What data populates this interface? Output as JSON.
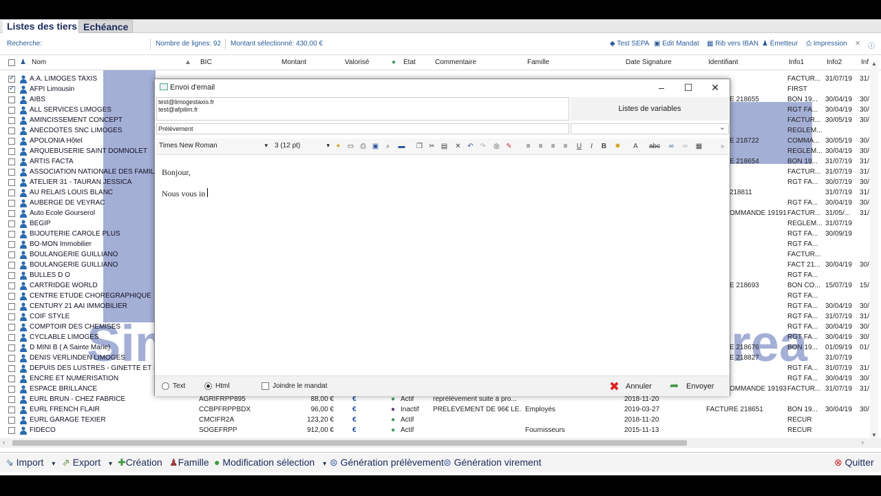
{
  "app": {
    "tabs": [
      "Listes des tiers",
      "Echéance"
    ]
  },
  "infobar": {
    "search_label": "Recherche:",
    "rows_count": "Nombre de lignes: 92",
    "amount_selected": "Montant sélectionné: 430,00 €",
    "tools": [
      "Test SEPA",
      "Edit Mandat",
      "Rib vers IBAN",
      "Émetteur",
      "Impression"
    ]
  },
  "table": {
    "headers": [
      "Nom",
      "BIC",
      "Montant",
      "Valorisé",
      "Etat",
      "Commentaire",
      "Famille",
      "Date Signature",
      "Identifiant",
      "Info1",
      "Info2",
      "Inf"
    ],
    "rows": [
      {
        "name": "A.A. LIMOGES TAXIS",
        "checked": true,
        "info1": "FACTUR...",
        "info2": "31/07/19",
        "info3": "31/"
      },
      {
        "name": "AFPI Limousin",
        "checked": true,
        "info1": "FIRST",
        "info2": "",
        "info3": ""
      },
      {
        "name": "AIBS",
        "checked": false,
        "ident": "E 218655",
        "info1": "BON 19...",
        "info2": "30/04/19",
        "info3": "30/"
      },
      {
        "name": "ALL SERVICES LIMOGES",
        "checked": false,
        "info1": "RGT FA...",
        "info2": "30/04/19",
        "info3": "30/"
      },
      {
        "name": "AMINCISSEMENT CONCEPT",
        "checked": false,
        "info1": "FACTUR...",
        "info2": "30/05/19",
        "info3": "30/"
      },
      {
        "name": "ANECDOTES SNC LIMOGES",
        "checked": false,
        "info1": "REGLEM...",
        "info2": "",
        "info3": ""
      },
      {
        "name": "APOLONIA Hôtel",
        "checked": false,
        "ident": "E 218722",
        "info1": "COMMA...",
        "info2": "30/05/19",
        "info3": "30/"
      },
      {
        "name": "ARQUEBUSERIE SAINT DOMNOLET",
        "checked": false,
        "info1": "REGLEM...",
        "info2": "30/04/19",
        "info3": "30/"
      },
      {
        "name": "ARTIS FACTA",
        "checked": false,
        "ident": "E 218654",
        "info1": "BON 19...",
        "info2": "31/07/19",
        "info3": "31/"
      },
      {
        "name": "ASSOCIATION NATIONALE DES FAMILL",
        "checked": false,
        "info1": "FACTUR...",
        "info2": "31/07/19",
        "info3": "31/"
      },
      {
        "name": "ATELIER 31 - TAURAN JESSICA",
        "checked": false,
        "info1": "RGT FA...",
        "info2": "30/07/19",
        "info3": "30/"
      },
      {
        "name": "AU RELAIS LOUIS BLANC",
        "checked": false,
        "ident": "218811",
        "info1": "",
        "info2": "31/07/19",
        "info3": "31/"
      },
      {
        "name": "AUBERGE DE VEYRAC",
        "checked": false,
        "info1": "RGT FA...",
        "info2": "30/04/19",
        "info3": "30/"
      },
      {
        "name": "Auto Ecole Gourserol",
        "checked": false,
        "ident": "OMMANDE 19191",
        "info1": "FACTUR...",
        "info2": "31/05/...",
        "info3": "31/"
      },
      {
        "name": "BEGIP",
        "checked": false,
        "info1": "REGLEM...",
        "info2": "31/07/19",
        "info3": ""
      },
      {
        "name": "BIJOUTERIE CAROLE PLUS",
        "checked": false,
        "info1": "RGT FA...",
        "info2": "30/09/19",
        "info3": ""
      },
      {
        "name": "BO-MON Immobilier",
        "checked": false,
        "info1": "RGT FA...",
        "info2": "",
        "info3": ""
      },
      {
        "name": "BOULANGERIE GUILLIANO",
        "checked": false,
        "info1": "FACTUR...",
        "info2": "",
        "info3": ""
      },
      {
        "name": "BOULANGERIE GUILLIANO",
        "checked": false,
        "info1": "FACT 21...",
        "info2": "30/04/19",
        "info3": "30/"
      },
      {
        "name": "BULLES D O",
        "checked": false,
        "info1": "RGT FA...",
        "info2": "",
        "info3": ""
      },
      {
        "name": "CARTRIDGE WORLD",
        "checked": false,
        "ident": "E 218693",
        "info1": "BON CO...",
        "info2": "15/07/19",
        "info3": "15/"
      },
      {
        "name": "CENTRE ETUDE CHOREGRAPHIQUE",
        "checked": false,
        "info1": "RGT FA...",
        "info2": "",
        "info3": ""
      },
      {
        "name": "CENTURY 21 AAI IMMOBILIER",
        "checked": false,
        "info1": "RGT FA...",
        "info2": "30/04/19",
        "info3": "30/"
      },
      {
        "name": "COIF STYLE",
        "checked": false,
        "info1": "RGT FA...",
        "info2": "31/07/19",
        "info3": "31/"
      },
      {
        "name": "COMPTOIR DES CHEMISES",
        "checked": false,
        "info1": "RGT FA...",
        "info2": "30/04/19",
        "info3": "30/"
      },
      {
        "name": "CYCLABLE LIMOGES",
        "checked": false,
        "info1": "RGT FA...",
        "info2": "30/04/19",
        "info3": "30/"
      },
      {
        "name": "D MINI B ( A Sainte Marie)",
        "checked": false,
        "ident": "E 218676",
        "info1": "BON 19...",
        "info2": "01/09/19",
        "info3": "01/"
      },
      {
        "name": "DENIS VERLINDEN LIMOGES",
        "checked": false,
        "ident": "E 218827",
        "info1": "",
        "info2": "31/07/19",
        "info3": ""
      },
      {
        "name": "DEPUIS DES LUSTRES - GINETTE ET S",
        "checked": false,
        "info1": "RGT FA...",
        "info2": "31/07/19",
        "info3": "31/"
      },
      {
        "name": "ENCRE ET NUMERISATION",
        "checked": false,
        "info1": "RGT FA...",
        "info2": "30/04/19",
        "info3": "30/"
      },
      {
        "name": "ESPACE BRILLANCE",
        "checked": false,
        "ident": "OMMANDE 19193",
        "info1": "FACTUR...",
        "info2": "31/07/19",
        "info3": "31/"
      },
      {
        "name": "EURL BRUN - CHEZ FABRICE",
        "checked": false,
        "bic": "AGRIFRPP895",
        "montant": "88,00 €",
        "etat": "Actif",
        "etat_color": "#3a9a5a",
        "comment": "reprélèvement suite à pro...",
        "famille": "",
        "date": "2018-11-20",
        "info1": "",
        "info2": "",
        "info3": ""
      },
      {
        "name": "EURL FRENCH FLAIR",
        "checked": false,
        "bic": "CCBPFRPPBDX",
        "montant": "96,00 €",
        "etat": "Inactif",
        "etat_color": "#5a3a7a",
        "comment": "PRELEVEMENT DE 96€ LE...",
        "famille": "Employés",
        "date": "2019-03-27",
        "ident": "FACTURE 218651",
        "info1": "BON 19...",
        "info2": "30/04/19",
        "info3": "30/"
      },
      {
        "name": "EURL GARAGE TEXIER",
        "checked": false,
        "bic": "CMCIFR2A",
        "montant": "123,20 €",
        "etat": "Actif",
        "etat_color": "#3a9a5a",
        "comment": "",
        "famille": "",
        "date": "2018-11-20",
        "info1": "RECUR",
        "info2": "",
        "info3": ""
      },
      {
        "name": "FIDECO",
        "checked": false,
        "bic": "SOGEFRPP",
        "montant": "912,00 €",
        "etat": "Actif",
        "etat_color": "#3a9a5a",
        "comment": "",
        "famille": "Fournisseurs",
        "date": "2015-11-13",
        "info1": "RECUR",
        "info2": "",
        "info3": ""
      }
    ]
  },
  "dialog": {
    "title": "Envoi d'email",
    "recipients": [
      "test@limogestaxis.fr",
      "test@afpilim.fr"
    ],
    "vars_button": "Listes de variables",
    "subject": "Prélèvement",
    "font": "Times New Roman",
    "size": "3 (12 pt)",
    "body_lines": [
      "Bonjour,",
      "Nous vous in"
    ],
    "format_text": "Text",
    "format_html": "Html",
    "attach_mandate": "Joindre le mandat",
    "cancel": "Annuler",
    "send": "Envoyer"
  },
  "bottombar": {
    "items": [
      "Import",
      "Export",
      "Création",
      "Famille",
      "Modification sélection",
      "Génération prélèvement",
      "Génération virement",
      "Quitter"
    ]
  },
  "watermark": {
    "left": "Sim",
    "right": "rea"
  }
}
